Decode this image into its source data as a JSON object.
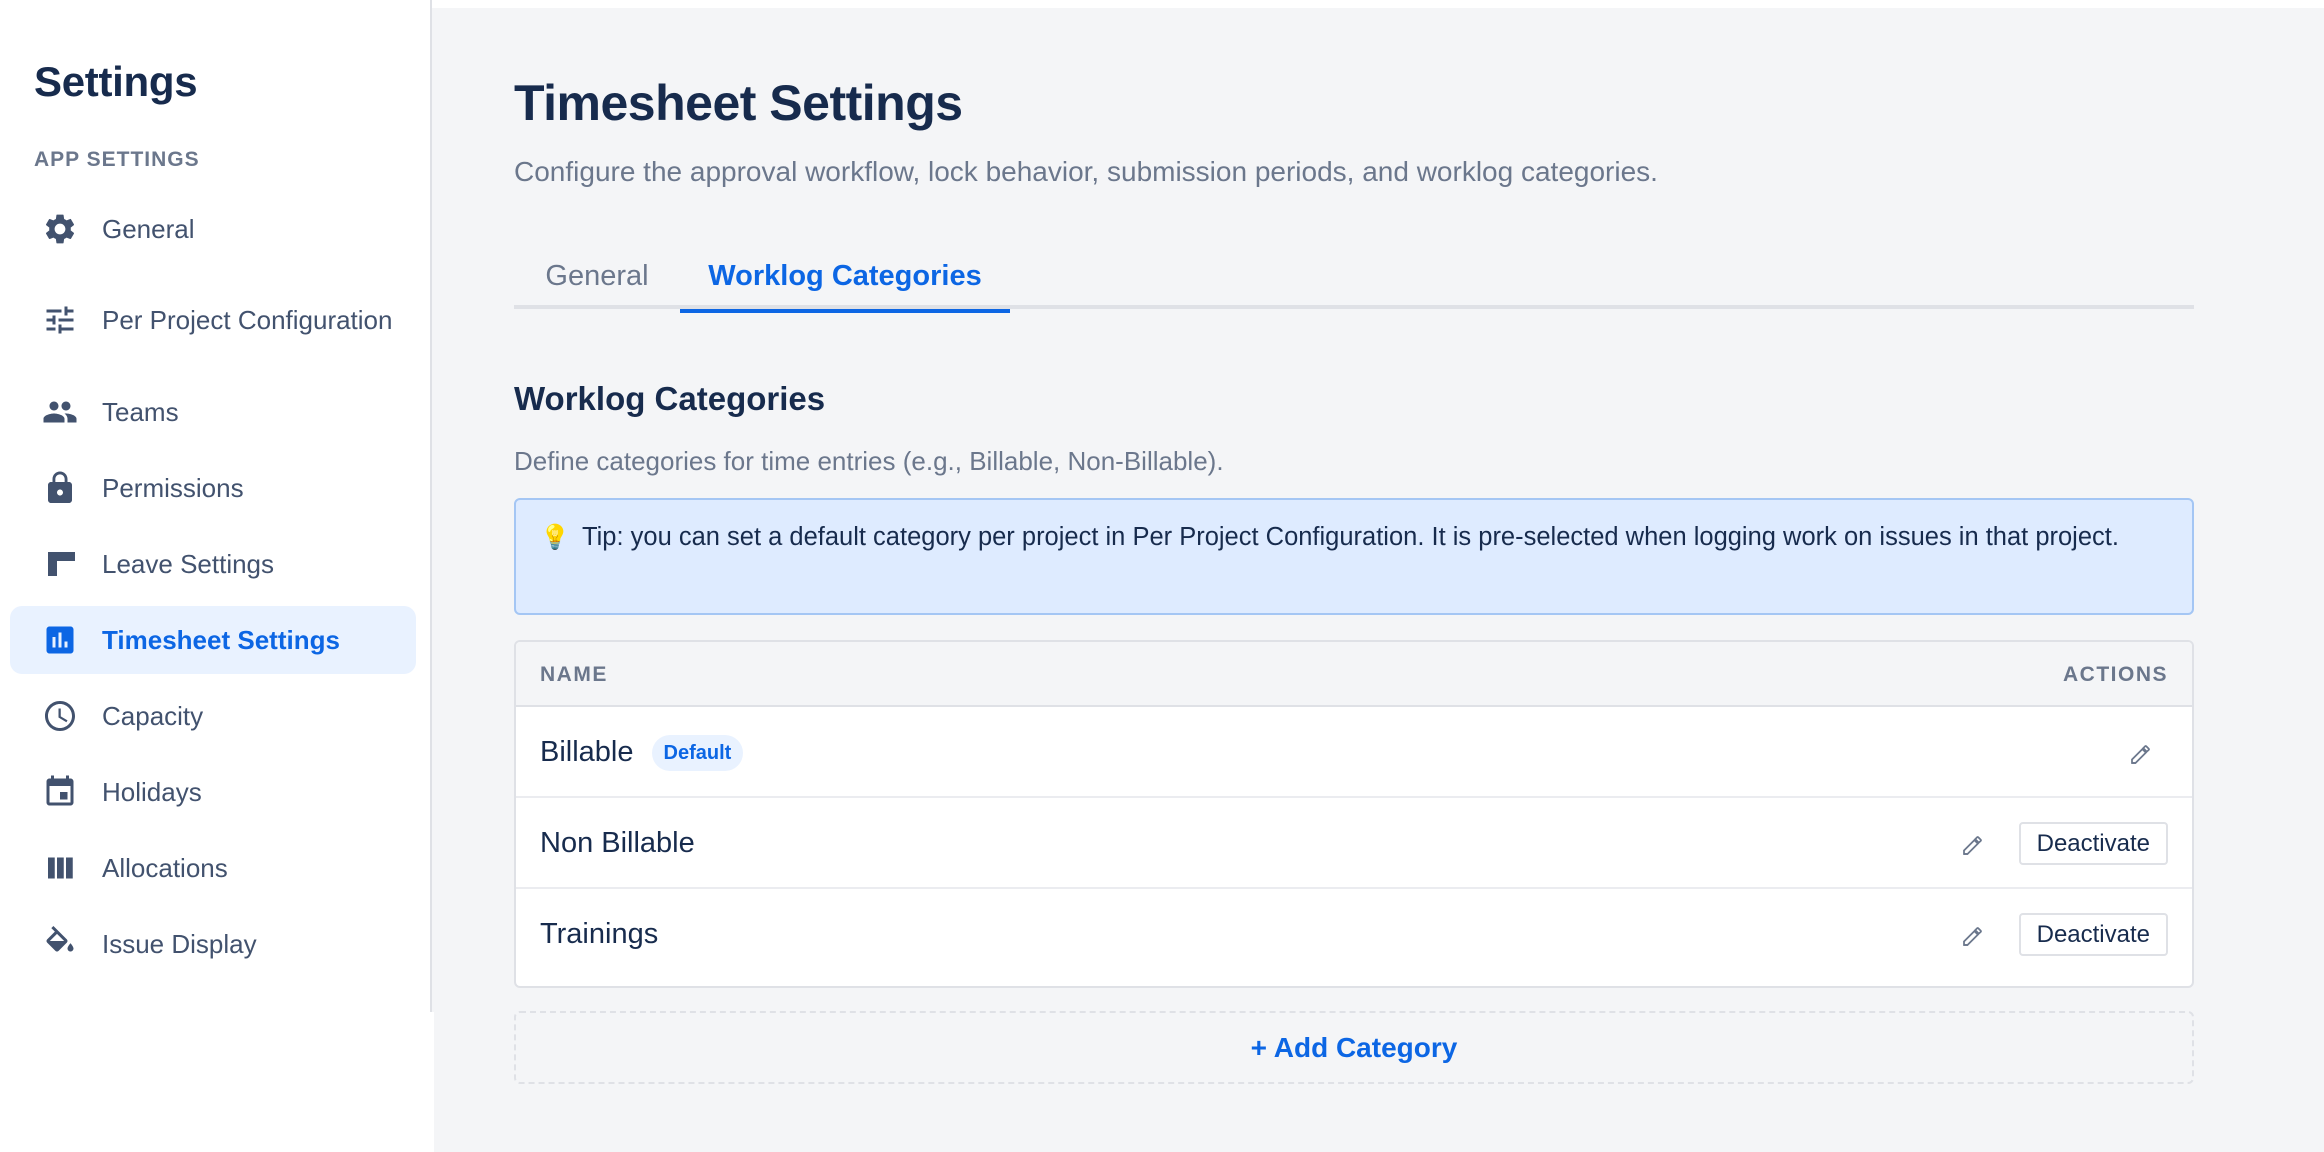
{
  "sidebar": {
    "title": "Settings",
    "section": "APP SETTINGS",
    "items": [
      {
        "label": "General",
        "icon": "gear-icon"
      },
      {
        "label": "Per Project Configuration",
        "icon": "sliders-icon"
      },
      {
        "label": "Teams",
        "icon": "people-icon"
      },
      {
        "label": "Permissions",
        "icon": "lock-icon"
      },
      {
        "label": "Leave Settings",
        "icon": "window-icon"
      },
      {
        "label": "Timesheet Settings",
        "icon": "bar-chart-icon",
        "active": true
      },
      {
        "label": "Capacity",
        "icon": "clock-icon"
      },
      {
        "label": "Holidays",
        "icon": "calendar-icon"
      },
      {
        "label": "Allocations",
        "icon": "columns-icon"
      },
      {
        "label": "Issue Display",
        "icon": "paint-bucket-icon"
      }
    ]
  },
  "main": {
    "title": "Timesheet Settings",
    "subtitle": "Configure the approval workflow, lock behavior, submission periods, and worklog categories.",
    "tabs": [
      {
        "label": "General",
        "active": false
      },
      {
        "label": "Worklog Categories",
        "active": true
      }
    ],
    "section": {
      "title": "Worklog Categories",
      "description": "Define categories for time entries (e.g., Billable, Non-Billable).",
      "tip": {
        "icon": "lightbulb-icon",
        "text": "Tip: you can set a default category per project in Per Project Configuration. It is pre-selected when logging work on issues in that project."
      },
      "table": {
        "columns": [
          "NAME",
          "ACTIONS"
        ],
        "rows": [
          {
            "name": "Billable",
            "badge": "Default",
            "edit_icon": "pencil-icon"
          },
          {
            "name": "Non Billable",
            "edit_icon": "pencil-icon",
            "action": "Deactivate"
          },
          {
            "name": "Trainings",
            "edit_icon": "pencil-icon",
            "action": "Deactivate"
          }
        ]
      },
      "add_label": "+ Add Category"
    }
  },
  "colors": {
    "accent": "#0c66e4",
    "text": "#172b4d",
    "muted": "#6b778c",
    "tip_bg": "#deebff",
    "page_bg": "#f4f5f7"
  }
}
